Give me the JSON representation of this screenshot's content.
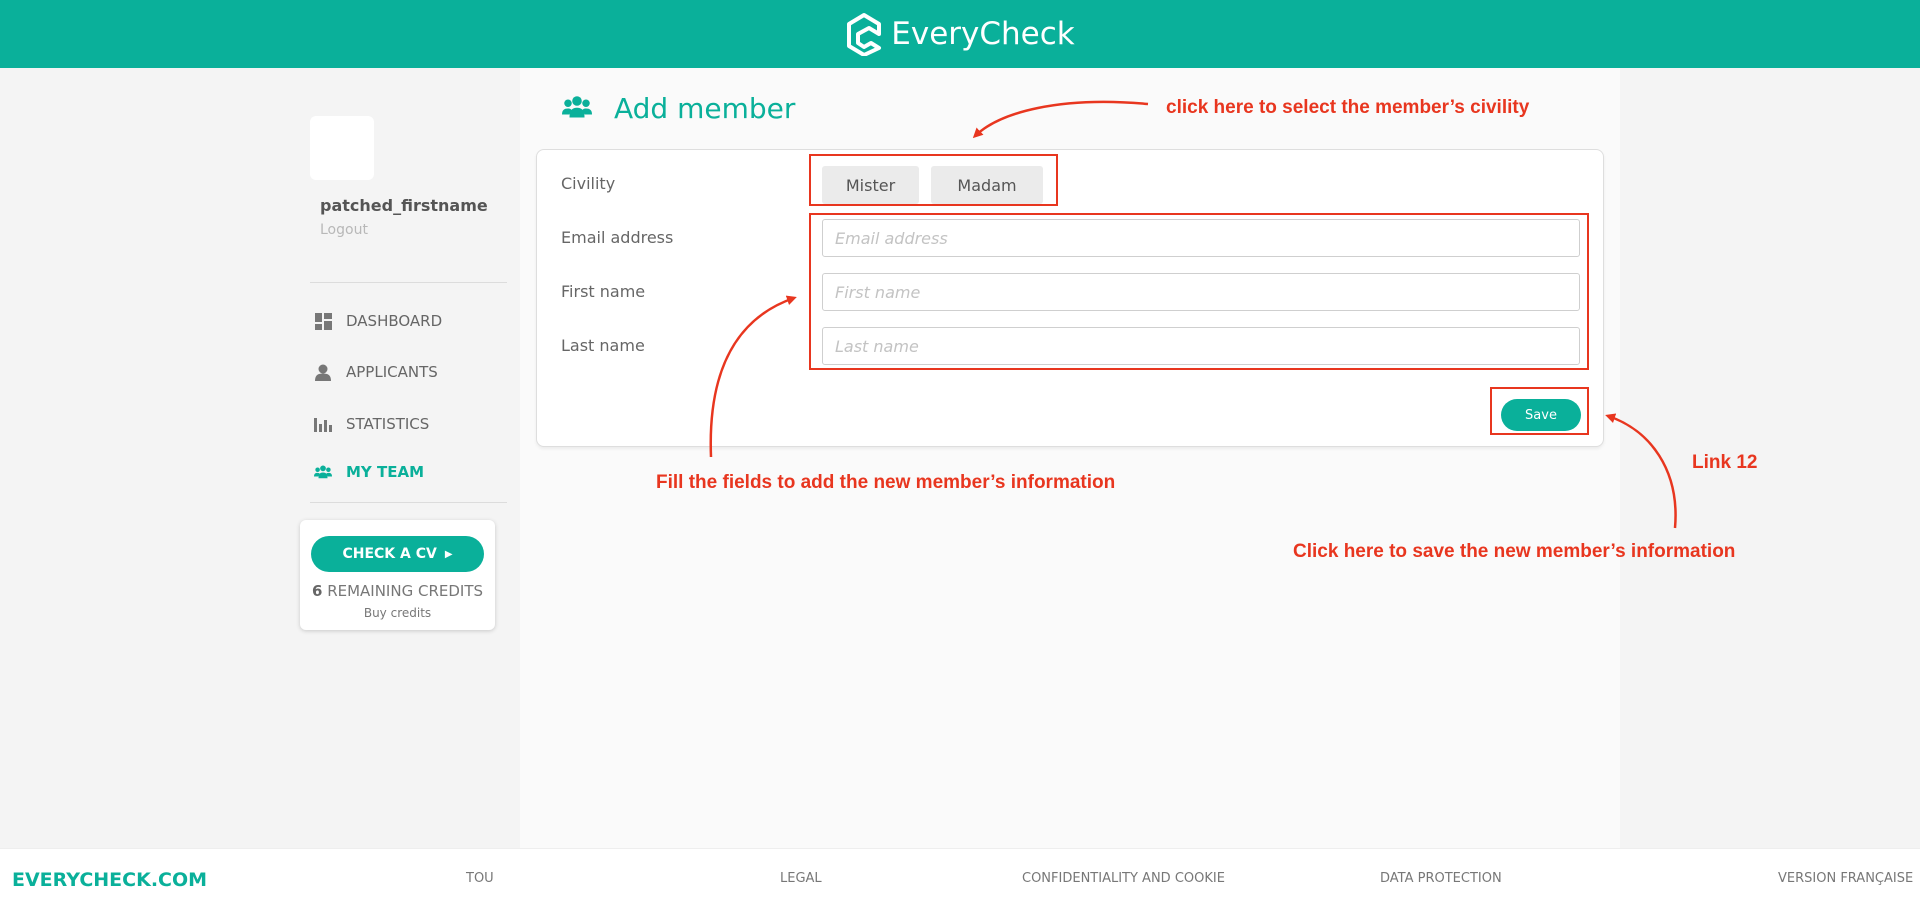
{
  "header": {
    "brand": "EveryCheck"
  },
  "sidebar": {
    "username": "patched_firstname",
    "logout": "Logout",
    "nav": [
      {
        "label": "DASHBOARD",
        "icon": "dashboard-icon"
      },
      {
        "label": "APPLICANTS",
        "icon": "user-icon"
      },
      {
        "label": "STATISTICS",
        "icon": "bar-chart-icon"
      },
      {
        "label": "MY TEAM",
        "icon": "team-icon",
        "active": true
      }
    ],
    "cv_card": {
      "button": "CHECK A CV",
      "credits_count": "6",
      "credits_label": "REMAINING CREDITS",
      "buy": "Buy credits"
    }
  },
  "main": {
    "title": "Add member",
    "form": {
      "civility_label": "Civility",
      "civility_options": [
        "Mister",
        "Madam"
      ],
      "email_label": "Email address",
      "email_placeholder": "Email address",
      "first_name_label": "First name",
      "first_name_placeholder": "First name",
      "last_name_label": "Last name",
      "last_name_placeholder": "Last name",
      "save": "Save"
    }
  },
  "annotations": {
    "civility_hint": "click here to select the member’s civility",
    "fields_hint": "Fill the fields to add the new member’s information",
    "save_hint": "Click here to save the new member’s information",
    "link": "Link 12",
    "color": "#e8361f"
  },
  "footer": {
    "brand": "EVERYCHECK.COM",
    "links": [
      "TOU",
      "LEGAL",
      "CONFIDENTIALITY AND COOKIE",
      "DATA PROTECTION",
      "VERSION FRANÇAISE"
    ]
  },
  "colors": {
    "accent": "#0ab09a"
  }
}
